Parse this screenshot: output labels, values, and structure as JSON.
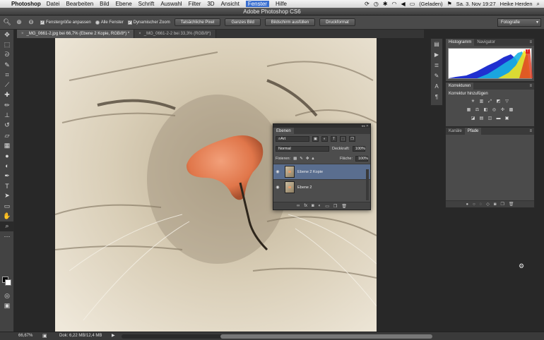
{
  "menubar": {
    "app": "Photoshop",
    "items": [
      "Datei",
      "Bearbeiten",
      "Bild",
      "Ebene",
      "Schrift",
      "Auswahl",
      "Filter",
      "3D",
      "Ansicht",
      "Fenster",
      "Hilfe"
    ],
    "active_index": 9,
    "battery": "(Geladen)",
    "datetime": "Sa. 3. Nov  19:27",
    "user": "Heike Herden"
  },
  "window": {
    "title": "Adobe Photoshop CS6"
  },
  "options": {
    "check1": "Fenstergröße anpassen",
    "check2": "Alle Fenster",
    "check3": "Dynamischer Zoom",
    "btn1": "Tatsächliche Pixel",
    "btn2": "Ganzes Bild",
    "btn3": "Bildschirm ausfüllen",
    "btn4": "Druckformat",
    "workspace": "Fotografie"
  },
  "tabs": [
    {
      "label": "_MG_0661-2.jpg bei 66,7% (Ebene 2 Kopie, RGB/8*) *",
      "active": true
    },
    {
      "label": "_MG_0661-2-2 bei 33,3% (RGB/8*)",
      "active": false
    }
  ],
  "status": {
    "zoom": "66,67%",
    "doc": "Dok: 6,22 MB/12,4 MB"
  },
  "panels": {
    "histogram_tab": "Histogramm",
    "navigator_tab": "Navigator",
    "korrekturen_tab": "Korrekturen",
    "korrektur_add": "Korrektur hinzufügen",
    "kanaele_tab": "Kanäle",
    "pfade_tab": "Pfade"
  },
  "layers": {
    "tab": "Ebenen",
    "filter": "Art",
    "blend": "Normal",
    "opacity_label": "Deckkraft:",
    "opacity": "100%",
    "lock_label": "Fixieren:",
    "fill_label": "Fläche:",
    "fill": "100%",
    "items": [
      {
        "name": "Ebene 2 Kopie",
        "selected": true
      },
      {
        "name": "Ebene 2",
        "selected": false
      }
    ]
  },
  "colors": {
    "accent_menu": "#3a6fd0",
    "selected_layer": "#5a6e8f",
    "nose": "#e8845a"
  }
}
